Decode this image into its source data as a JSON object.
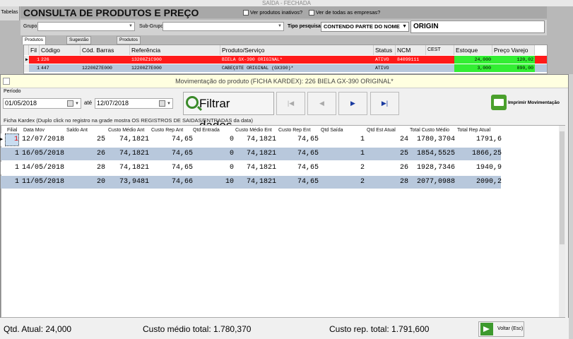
{
  "app": {
    "window_title": "SAÍDA - FECHADA",
    "side_tab": "Tabelas"
  },
  "header": {
    "title": "CONSULTA DE PRODUTOS E PREÇO",
    "opt_inativos": "Ver produtos inativos?",
    "opt_empresas": "Ver de todas as empresas?"
  },
  "filters": {
    "grupo_label": "Grupo",
    "subgrupo_label": "Sub-Grupo",
    "tipo_label": "Tipo pesquisa",
    "tipo_value": "CONTENDO PARTE DO NOME",
    "search_value": "ORIGIN"
  },
  "tabs": [
    "Produtos e serviços",
    "Sugestão para vendas",
    "Produtos similares"
  ],
  "prod_grid": {
    "headers": [
      "Fil",
      "Código",
      "Cód. Barras",
      "Referência",
      "Produto/Serviço",
      "Status",
      "NCM",
      "CEST",
      "Estoque",
      "Preço Varejo"
    ],
    "rows": [
      {
        "fil": "1",
        "codigo": "226",
        "barras": "",
        "referencia": "13200Z1C900",
        "produto": "BIELA GX-390 ORIGINAL*",
        "status": "ATIVO",
        "ncm": "84099111",
        "cest": "",
        "estoque": "24,000",
        "preco": "120,02"
      },
      {
        "fil": "1",
        "codigo": "447",
        "barras": "12200Z7E000",
        "referencia": "12200Z7E000",
        "produto": "CABEÇOTE ORIGINAL (GX390)*",
        "status": "ATIVO",
        "ncm": "",
        "cest": "",
        "estoque": "3,000",
        "preco": "890,00"
      }
    ]
  },
  "modal": {
    "title": "Movimentação do produto (FICHA KARDEX): 226 BIELA GX-390 ORIGINAL*",
    "periodo_label": "Período",
    "date_from": "01/05/2018",
    "ate_label": "até",
    "date_to": "12/07/2018",
    "filtrar_label": "Filtrar dados...",
    "nav": [
      "|◀",
      "◀",
      "▶",
      "▶|"
    ],
    "imprimir_label": "Imprimir Movimentação",
    "hint": "Ficha Kardex (Duplo click no registro na grade mostra OS REGISTROS DE SAIDAS/ENTRADAS da data)"
  },
  "kardex": {
    "headers": [
      "Filial",
      "Data Mov",
      "Saldo Ant",
      "Custo Médio Ant",
      "Custo Rep Ant",
      "Qtd Entrada",
      "Custo Médio Ent",
      "Custo Rep Ent",
      "Qtd Saída",
      "Qtd Est Atual",
      "Total Custo Médio",
      "Total Rep Atual"
    ],
    "rows": [
      [
        "1",
        "12/07/2018",
        "25",
        "74,1821",
        "74,65",
        "0",
        "74,1821",
        "74,65",
        "1",
        "24",
        "1780,3704",
        "1791,6"
      ],
      [
        "1",
        "16/05/2018",
        "26",
        "74,1821",
        "74,65",
        "0",
        "74,1821",
        "74,65",
        "1",
        "25",
        "1854,5525",
        "1866,25"
      ],
      [
        "1",
        "14/05/2018",
        "28",
        "74,1821",
        "74,65",
        "0",
        "74,1821",
        "74,65",
        "2",
        "26",
        "1928,7346",
        "1940,9"
      ],
      [
        "1",
        "11/05/2018",
        "20",
        "73,9481",
        "74,66",
        "10",
        "74,1821",
        "74,65",
        "2",
        "28",
        "2077,0988",
        "2090,2"
      ]
    ]
  },
  "footer": {
    "qtd_atual": "Qtd. Atual: 24,000",
    "custo_medio_total": "Custo médio total: 1.780,370",
    "custo_rep_total": "Custo rep. total: 1.791,600",
    "voltar_label": "Voltar (Esc)"
  },
  "colors": {
    "selected_row": "#ff1a1a",
    "green_cell": "#33ee33",
    "alt_row": "#b8c8dc"
  }
}
